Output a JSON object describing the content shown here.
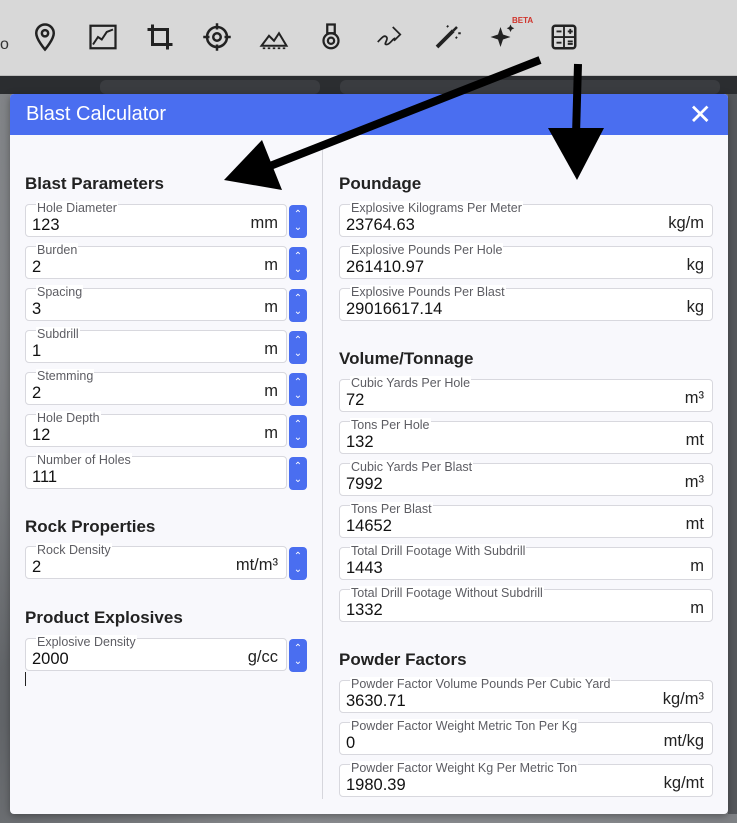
{
  "toolbar": {
    "icons": [
      "location-pin-icon",
      "profile-chart-icon",
      "crop-icon",
      "target-icon",
      "terrain-icon",
      "drill-icon",
      "signature-icon",
      "magic-wand-icon",
      "sparkles-icon",
      "calculator-icon"
    ],
    "beta_label": "BETA"
  },
  "modal": {
    "title": "Blast Calculator",
    "close_glyph": "✕"
  },
  "blast_parameters": {
    "title": "Blast Parameters",
    "fields": [
      {
        "label": "Hole Diameter",
        "value": "123",
        "unit": "mm"
      },
      {
        "label": "Burden",
        "value": "2",
        "unit": "m"
      },
      {
        "label": "Spacing",
        "value": "3",
        "unit": "m"
      },
      {
        "label": "Subdrill",
        "value": "1",
        "unit": "m"
      },
      {
        "label": "Stemming",
        "value": "2",
        "unit": "m"
      },
      {
        "label": "Hole Depth",
        "value": "12",
        "unit": "m"
      },
      {
        "label": "Number of Holes",
        "value": "111",
        "unit": ""
      }
    ]
  },
  "rock_properties": {
    "title": "Rock Properties",
    "fields": [
      {
        "label": "Rock Density",
        "value": "2",
        "unit": "mt/m³"
      }
    ]
  },
  "product_explosives": {
    "title": "Product Explosives",
    "fields": [
      {
        "label": "Explosive Density",
        "value": "2000",
        "unit": "g/cc"
      }
    ]
  },
  "poundage": {
    "title": "Poundage",
    "fields": [
      {
        "label": "Explosive Kilograms Per Meter",
        "value": "23764.63",
        "unit": "kg/m"
      },
      {
        "label": "Explosive Pounds Per Hole",
        "value": "261410.97",
        "unit": "kg"
      },
      {
        "label": "Explosive Pounds Per Blast",
        "value": "29016617.14",
        "unit": "kg"
      }
    ]
  },
  "volume_tonnage": {
    "title": "Volume/Tonnage",
    "fields": [
      {
        "label": "Cubic Yards Per Hole",
        "value": "72",
        "unit": "m³"
      },
      {
        "label": "Tons Per Hole",
        "value": "132",
        "unit": "mt"
      },
      {
        "label": "Cubic Yards Per Blast",
        "value": "7992",
        "unit": "m³"
      },
      {
        "label": "Tons Per Blast",
        "value": "14652",
        "unit": "mt"
      },
      {
        "label": "Total Drill Footage With Subdrill",
        "value": "1443",
        "unit": "m"
      },
      {
        "label": "Total Drill Footage Without Subdrill",
        "value": "1332",
        "unit": "m"
      }
    ]
  },
  "powder_factors": {
    "title": "Powder Factors",
    "fields": [
      {
        "label": "Powder Factor Volume Pounds Per Cubic Yard",
        "value": "3630.71",
        "unit": "kg/m³"
      },
      {
        "label": "Powder Factor Weight Metric Ton Per Kg",
        "value": "0",
        "unit": "mt/kg"
      },
      {
        "label": "Powder Factor Weight Kg Per Metric Ton",
        "value": "1980.39",
        "unit": "kg/mt"
      }
    ]
  },
  "colors": {
    "accent": "#4a6ef0",
    "modal_bg": "#f8f8fc",
    "toolbar_bg": "#d8d8d8"
  }
}
